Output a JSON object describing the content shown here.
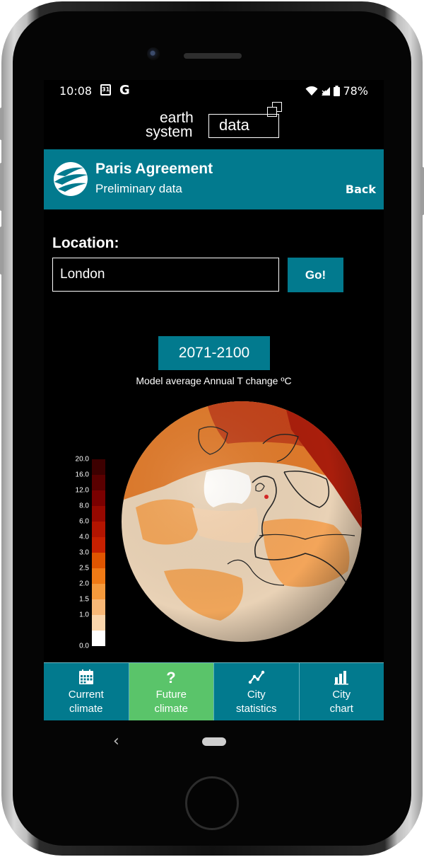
{
  "status_bar": {
    "time": "10:08",
    "calendar_day": "31",
    "google_glyph": "G",
    "battery": "78%"
  },
  "logo": {
    "word1": "earth",
    "word2": "system",
    "word3": "data"
  },
  "header": {
    "title": "Paris Agreement",
    "subtitle": "Preliminary data",
    "back_label": "Back"
  },
  "location": {
    "label": "Location:",
    "value": "London",
    "go_label": "Go!"
  },
  "period": {
    "label": "2071-2100"
  },
  "map": {
    "caption": "Model average Annual T change ºC"
  },
  "legend": {
    "ticks": [
      "20.0",
      "16.0",
      "12.0",
      "8.0",
      "6.0",
      "4.0",
      "3.0",
      "2.5",
      "2.0",
      "1.5",
      "1.0",
      "0.0"
    ],
    "colors": [
      "#3d0000",
      "#5a0000",
      "#7a0000",
      "#960800",
      "#b31400",
      "#c72000",
      "#e05500",
      "#f07a15",
      "#f59a3c",
      "#f8b877",
      "#fbd6ac",
      "#ffffff"
    ]
  },
  "nav": {
    "items": [
      {
        "line1": "Current",
        "line2": "climate",
        "icon": "calendar-icon"
      },
      {
        "line1": "Future",
        "line2": "climate",
        "icon": "question-icon"
      },
      {
        "line1": "City",
        "line2": "statistics",
        "icon": "line-chart-icon"
      },
      {
        "line1": "City",
        "line2": "chart",
        "icon": "bar-chart-icon"
      }
    ],
    "active_color": "#5ac46a",
    "color": "#027a8e"
  },
  "colors": {
    "accent": "#027a8e",
    "active": "#5ac46a"
  }
}
